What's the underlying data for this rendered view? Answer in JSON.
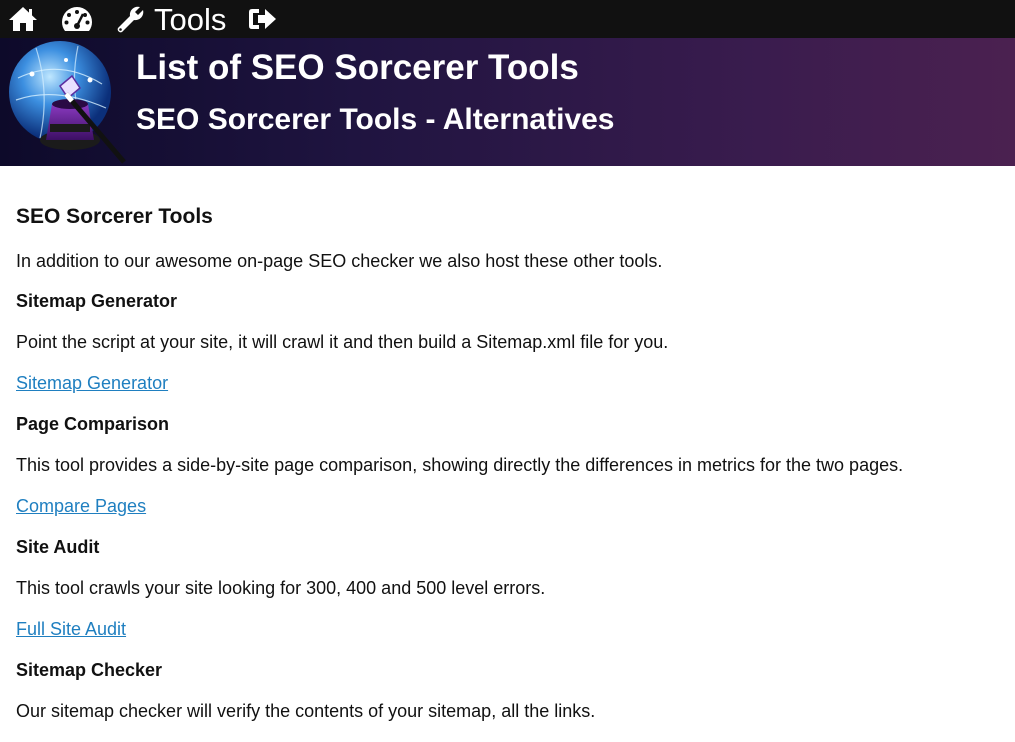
{
  "nav": {
    "tools_label": "Tools",
    "icons": [
      "home-icon",
      "dashboard-icon",
      "wrench-icon",
      "sign-out-icon"
    ]
  },
  "banner": {
    "title": "List of SEO Sorcerer Tools",
    "subtitle": "SEO Sorcerer Tools - Alternatives"
  },
  "content": {
    "heading": "SEO Sorcerer Tools",
    "intro": "In addition to our awesome on-page SEO checker we also host these other tools.",
    "sections": [
      {
        "title": "Sitemap Generator",
        "description": "Point the script at your site, it will crawl it and then build a Sitemap.xml file for you.",
        "link": "Sitemap Generator"
      },
      {
        "title": "Page Comparison",
        "description": "This tool provides a side-by-site page comparison, showing directly the differences in metrics for the two pages.",
        "link": "Compare Pages"
      },
      {
        "title": "Site Audit",
        "description": "This tool crawls your site looking for 300, 400 and 500 level errors.",
        "link": "Full Site Audit"
      },
      {
        "title": "Sitemap Checker",
        "description": "Our sitemap checker will verify the contents of your sitemap, all the links."
      }
    ]
  },
  "colors": {
    "nav_bg": "#111111",
    "banner_start": "#0d0a2a",
    "banner_end": "#4b2150",
    "link": "#1f7fc0"
  }
}
